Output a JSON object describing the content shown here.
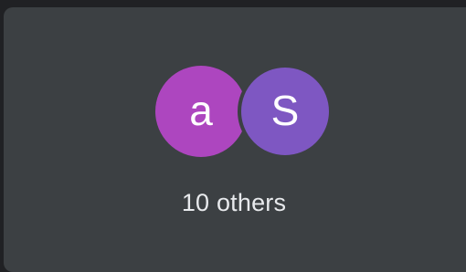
{
  "participants_tile": {
    "avatars": [
      {
        "initial": "a",
        "color": "#ad46bf"
      },
      {
        "initial": "S",
        "color": "#7e57c2"
      }
    ],
    "count_label": "10 others"
  }
}
